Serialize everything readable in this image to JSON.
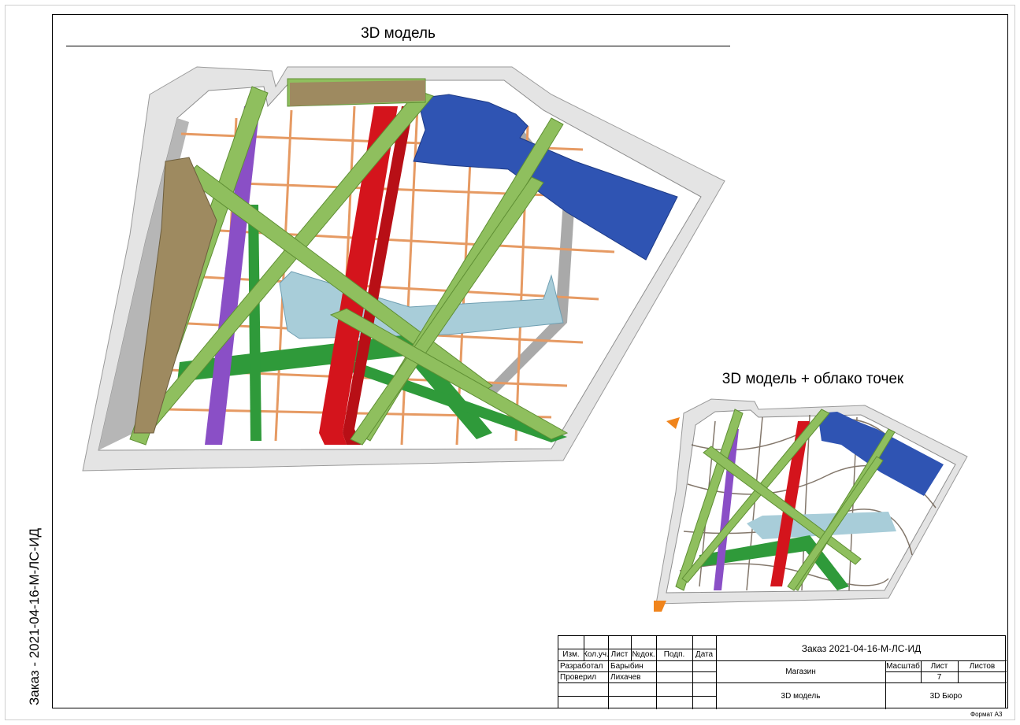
{
  "side_code": "Заказ - 2021-04-16-М-ЛС-ИД",
  "titles": {
    "model": "3D модель",
    "model_pointcloud": "3D модель + облако точек"
  },
  "stamp": {
    "order": "Заказ 2021-04-16-М-ЛС-ИД",
    "headers": {
      "izm": "Изм.",
      "kol_uch": "Кол.уч.",
      "list": "Лист",
      "ndok": "№док.",
      "podp": "Подп.",
      "data": "Дата"
    },
    "developed_label": "Разработал",
    "developed_name": "Барыбин",
    "checked_label": "Проверил",
    "checked_name": "Лихачев",
    "object": "Магазин",
    "scale_label": "Масштаб",
    "sheet_label": "Лист",
    "sheets_label": "Листов",
    "sheet_number": "7",
    "drawing_name": "3D модель",
    "organization": "3D Бюро"
  },
  "format": "Формат А3",
  "colors": {
    "wall": "#c8c8c8",
    "wall_dark": "#8e8e8e",
    "beam_green_light": "#8fbf5e",
    "duct_green": "#2f9a3a",
    "duct_red": "#d4141c",
    "duct_purple": "#8a4fc6",
    "duct_blue": "#2f54b3",
    "duct_lightblue": "#a8cdd9",
    "grid_orange": "#e69a63",
    "beam_khaki": "#9e8a60"
  }
}
